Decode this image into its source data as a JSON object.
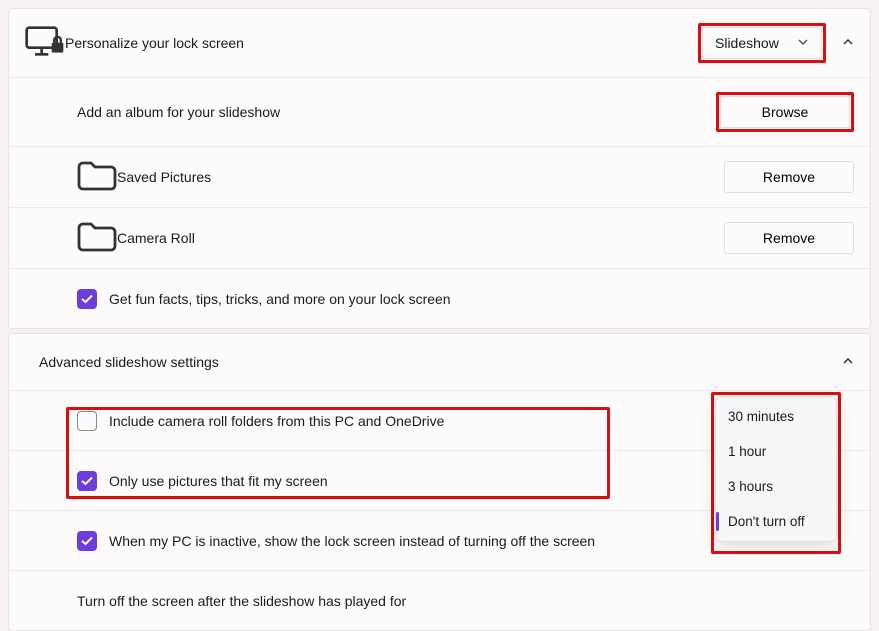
{
  "personalize": {
    "title": "Personalize your lock screen",
    "dropdown_value": "Slideshow",
    "add_album_label": "Add an album for your slideshow",
    "browse_label": "Browse",
    "albums": [
      {
        "name": "Saved Pictures",
        "action": "Remove"
      },
      {
        "name": "Camera Roll",
        "action": "Remove"
      }
    ],
    "fun_facts_label": "Get fun facts, tips, tricks, and more on your lock screen"
  },
  "advanced": {
    "title": "Advanced slideshow settings",
    "include_camera_roll_label": "Include camera roll folders from this PC and OneDrive",
    "fit_screen_label": "Only use pictures that fit my screen",
    "inactive_label": "When my PC is inactive, show the lock screen instead of turning off the screen",
    "turn_off_label": "Turn off the screen after the slideshow has played for",
    "turn_off_options": [
      "30 minutes",
      "1 hour",
      "3 hours",
      "Don't turn off"
    ],
    "turn_off_selected": "Don't turn off"
  }
}
